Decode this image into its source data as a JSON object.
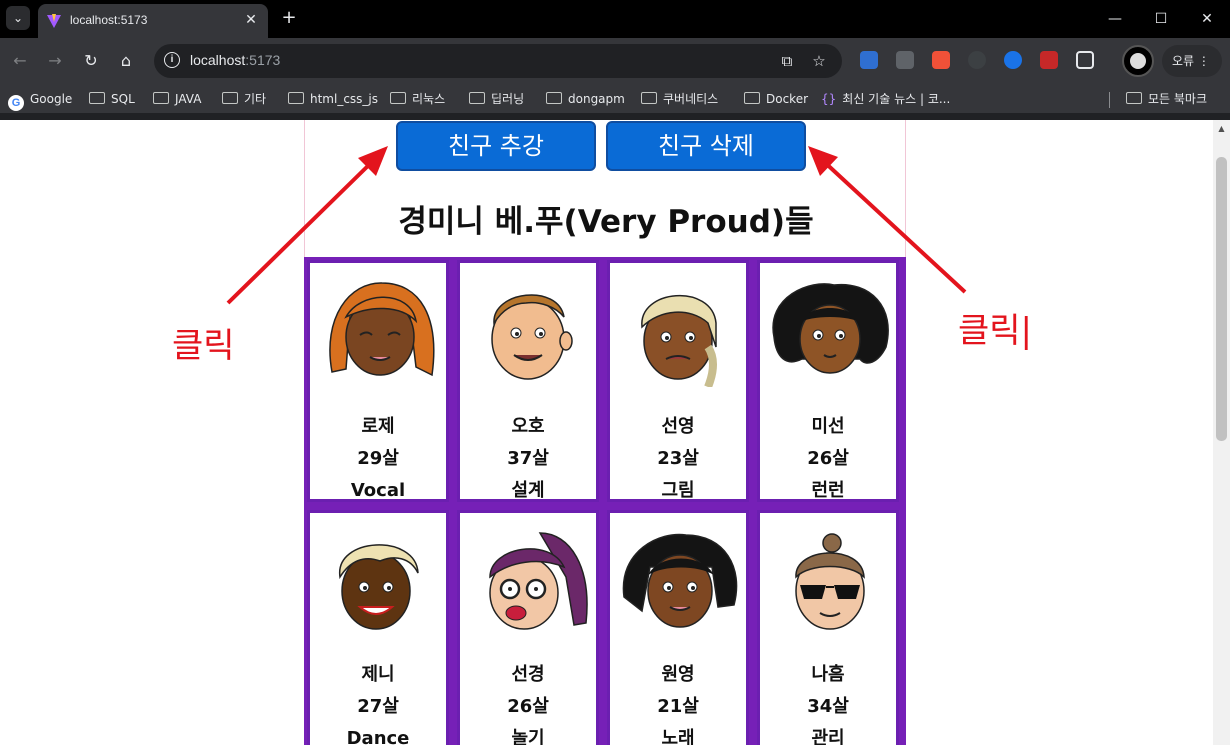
{
  "browser": {
    "tab_title": "localhost:5173",
    "url_host": "localhost",
    "url_port": ":5173",
    "profile_error_label": "오류",
    "bookmarks": [
      {
        "label": "Google",
        "icon": "google-icon"
      },
      {
        "label": "SQL",
        "icon": "folder-icon"
      },
      {
        "label": "JAVA",
        "icon": "folder-icon"
      },
      {
        "label": "기타",
        "icon": "folder-icon"
      },
      {
        "label": "html_css_js",
        "icon": "folder-icon"
      },
      {
        "label": "리눅스",
        "icon": "folder-icon"
      },
      {
        "label": "딥러닝",
        "icon": "folder-icon"
      },
      {
        "label": "dongapm",
        "icon": "folder-icon"
      },
      {
        "label": "쿠버네티스",
        "icon": "folder-icon"
      },
      {
        "label": "Docker",
        "icon": "folder-icon"
      },
      {
        "label": "최신 기술 뉴스 | 코...",
        "icon": "braces-icon"
      }
    ],
    "all_bookmarks_label": "모든 북마크"
  },
  "page": {
    "add_button": "친구 추강",
    "delete_button": "친구 삭제",
    "title": "경미니 베.푸(Very Proud)들",
    "friends": [
      {
        "name": "로제",
        "age": "29살",
        "role": "Vocal",
        "hair": "#d8701f",
        "skin": "#7a4521"
      },
      {
        "name": "오호",
        "age": "37살",
        "role": "설계",
        "hair": "#b6752c",
        "skin": "#f1bc8f"
      },
      {
        "name": "선영",
        "age": "23살",
        "role": "그림",
        "hair": "#eadfb1",
        "skin": "#8a5027"
      },
      {
        "name": "미선",
        "age": "26살",
        "role": "런런",
        "hair": "#141414",
        "skin": "#8e5426"
      },
      {
        "name": "제니",
        "age": "27살",
        "role": "Dance",
        "hair": "#eee2b2",
        "skin": "#5e3411"
      },
      {
        "name": "선경",
        "age": "26살",
        "role": "놀기",
        "hair": "#6b2869",
        "skin": "#f2c7a6"
      },
      {
        "name": "원영",
        "age": "21살",
        "role": "노래",
        "hair": "#141414",
        "skin": "#7e4722"
      },
      {
        "name": "나흠",
        "age": "34살",
        "role": "관리",
        "hair": "#8a6848",
        "skin": "#f1c7a6"
      }
    ]
  },
  "annotations": {
    "left_label": "클릭",
    "right_label": "클릭|",
    "color": "#e3141d"
  },
  "colors": {
    "button_bg": "#0a6bd6",
    "card_border": "#6b1fb0"
  }
}
